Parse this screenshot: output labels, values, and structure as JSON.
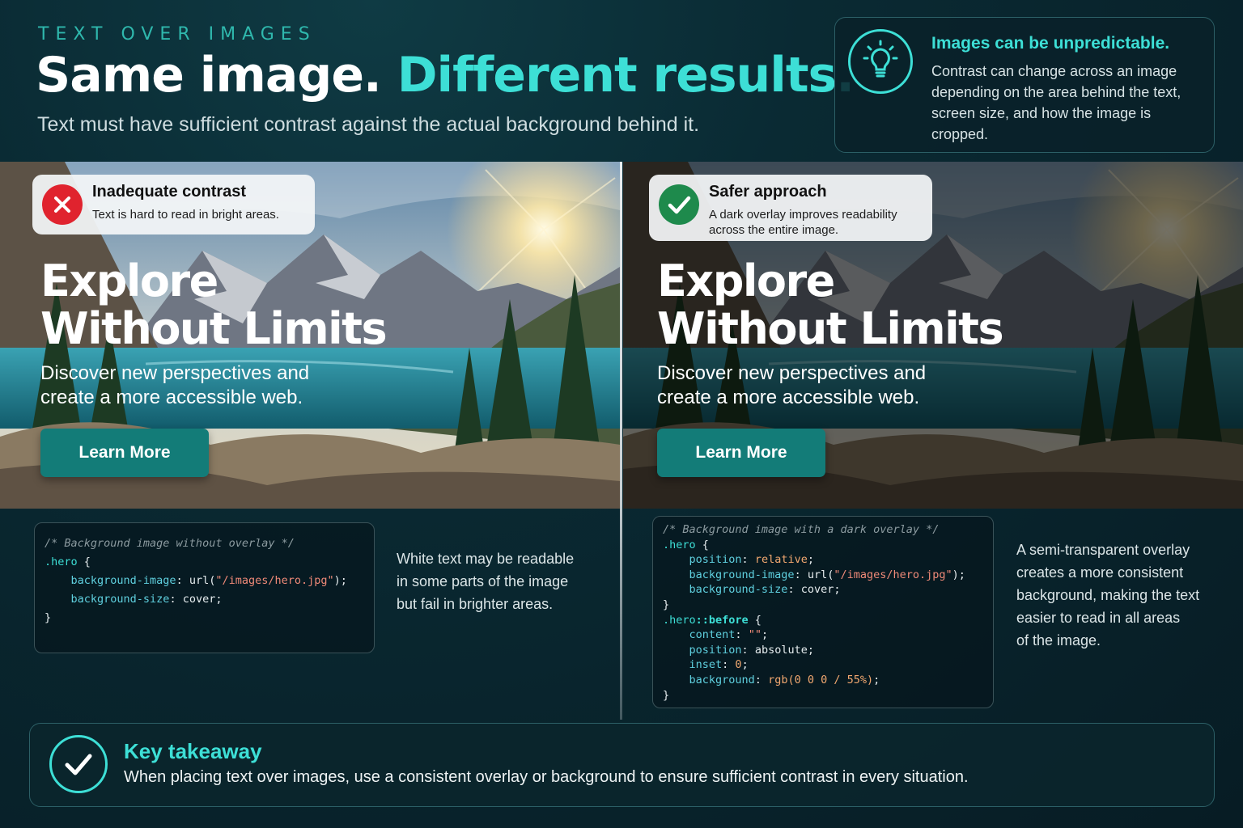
{
  "header": {
    "eyebrow": "TEXT OVER IMAGES",
    "headline_part1": "Same image.",
    "headline_part2": "Different results.",
    "subhead": "Text must have sufficient contrast against the actual background behind it."
  },
  "tip": {
    "icon": "lightbulb-icon",
    "title": "Images can be unpredictable.",
    "body": "Contrast can change across an image depending on the area behind the text, screen size, and how the image is cropped."
  },
  "examples": {
    "bad": {
      "badge_icon": "x-circle-icon",
      "badge_color": "#e0232e",
      "badge_title": "Inadequate contrast",
      "badge_desc": "Text is hard to read in bright areas.",
      "hero_title": "Explore\nWithout Limits",
      "hero_sub": "Discover new perspectives and\ncreate a more accessible web.",
      "cta": "Learn More",
      "note": "White text may be readable\nin some parts of the image\nbut fail in brighter areas."
    },
    "good": {
      "badge_icon": "check-circle-icon",
      "badge_color": "#1e8a4c",
      "badge_title": "Safer approach",
      "badge_desc": "A dark overlay improves readability across the entire image.",
      "hero_title": "Explore\nWithout Limits",
      "hero_sub": "Discover new perspectives and\ncreate a more accessible web.",
      "cta": "Learn More",
      "note": "A semi-transparent overlay\ncreates a more consistent\nbackground, making the text\neasier to read in all areas\nof the image."
    }
  },
  "code_left": {
    "comment": "/* Background image without overlay */",
    "selector": ".hero",
    "decls": [
      {
        "prop": "background-image",
        "fn": "url(",
        "str": "\"/images/hero.jpg\"",
        "end": ");"
      },
      {
        "prop": "background-size",
        "plain": "cover;"
      }
    ]
  },
  "code_right": {
    "comment": "/* Background image with a dark overlay */",
    "selector1": ".hero",
    "decls1": [
      {
        "prop": "position",
        "val": "relative",
        "end": ";"
      },
      {
        "prop": "background-image",
        "fn": "url(",
        "str": "\"/images/hero.jpg\"",
        "end": ");"
      },
      {
        "prop": "background-size",
        "plain": "cover;"
      }
    ],
    "selector2_a": ".hero",
    "selector2_b": "::before",
    "decls2": [
      {
        "prop": "content",
        "str": "\"\"",
        "end": ";"
      },
      {
        "prop": "position",
        "plain": "absolute;"
      },
      {
        "prop": "inset",
        "val": "0",
        "end": ";"
      },
      {
        "prop": "background",
        "val": "rgb(0 0 0 / 55%)",
        "end": ";"
      }
    ]
  },
  "takeaway": {
    "icon": "check-circle-icon",
    "title": "Key takeaway",
    "body": "When placing text over images, use a consistent overlay or background to ensure sufficient contrast in every situation."
  },
  "colors": {
    "accent": "#3ddfd6",
    "button": "#137c78",
    "background": "#0a2a33"
  }
}
